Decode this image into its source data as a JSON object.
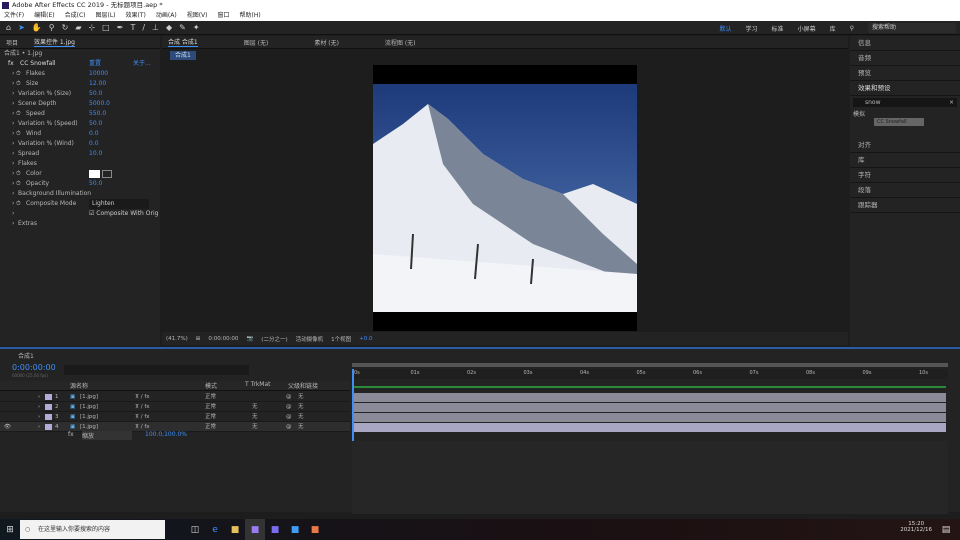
{
  "window": {
    "title": "Adobe After Effects CC 2019 - 无标题项目.aep *"
  },
  "menu": [
    "文件(F)",
    "编辑(E)",
    "合成(C)",
    "图层(L)",
    "效果(T)",
    "动画(A)",
    "视图(V)",
    "窗口",
    "帮助(H)"
  ],
  "toolbar": {
    "workspaces": [
      "默认",
      "学习",
      "标准",
      "小屏幕",
      "库"
    ],
    "search_placeholder": "搜索帮助"
  },
  "effects_panel": {
    "tabs": [
      "项目",
      "效果控件 1.jpg"
    ],
    "breadcrumb": "合成1 • 1.jpg",
    "effect_name": "CC Snowfall",
    "reset": "重置",
    "about": "关于...",
    "params": [
      {
        "name": "Flakes",
        "value": "10000",
        "stopwatch": true
      },
      {
        "name": "Size",
        "value": "12.00",
        "stopwatch": true
      },
      {
        "name": "Variation % (Size)",
        "value": "50.0"
      },
      {
        "name": "Scene Depth",
        "value": "5000.0"
      },
      {
        "name": "Speed",
        "value": "550.0",
        "stopwatch": true
      },
      {
        "name": "Variation % (Speed)",
        "value": "50.0"
      },
      {
        "name": "Wind",
        "value": "0.0",
        "stopwatch": true
      },
      {
        "name": "Variation % (Wind)",
        "value": "0.0"
      },
      {
        "name": "Spread",
        "value": "10.0"
      },
      {
        "name": "Flakes",
        "value": ""
      },
      {
        "name": "Color",
        "value": "",
        "stopwatch": true
      },
      {
        "name": "Opacity",
        "value": "50.0",
        "stopwatch": true
      },
      {
        "name": "Background Illumination",
        "value": ""
      },
      {
        "name": "Composite Mode",
        "value": "Lighten",
        "stopwatch": true
      },
      {
        "name": "",
        "value": "Composite With Orig"
      },
      {
        "name": "Extras",
        "value": ""
      }
    ]
  },
  "viewer": {
    "tabs": [
      "合成 合成1",
      "图层 (无)",
      "素材 (无)",
      "流程图 (无)"
    ],
    "comp_chip": "合成1",
    "zoom": "(41.7%)",
    "timecode": "0:00:00:00",
    "resolution": "(二分之一)",
    "camera": "活动摄像机",
    "views": "1个视图",
    "offset": "+0.0"
  },
  "right_panel": {
    "items_top": [
      "信息",
      "音频",
      "预览"
    ],
    "effects_presets": "效果和预设",
    "search_value": "snow",
    "category": "模拟",
    "result": "CC Snowfall",
    "items_bottom": [
      "对齐",
      "库",
      "字符",
      "段落",
      "跟踪器"
    ]
  },
  "timeline": {
    "tab": "合成1",
    "timecode": "0:00:00:00",
    "fps": "00000 (25.00 fps)",
    "search_placeholder": "",
    "columns": {
      "source": "源名称",
      "mode": "模式",
      "trkmat": "T TrkMat",
      "parent": "父级和链接"
    },
    "layers": [
      {
        "num": "1",
        "name": "[1.jpg]",
        "mode": "正常",
        "trk": "",
        "parent": "无"
      },
      {
        "num": "2",
        "name": "[1.jpg]",
        "mode": "正常",
        "trk": "无",
        "parent": "无"
      },
      {
        "num": "3",
        "name": "[1.jpg]",
        "mode": "正常",
        "trk": "无",
        "parent": "无"
      },
      {
        "num": "4",
        "name": "[1.jpg]",
        "mode": "正常",
        "trk": "无",
        "parent": "无"
      }
    ],
    "sublayer": {
      "label": "fx",
      "name": "缩放",
      "value": "100.0,100.0%"
    },
    "ruler": [
      "0s",
      "01s",
      "02s",
      "03s",
      "04s",
      "05s",
      "06s",
      "07s",
      "08s",
      "09s",
      "10s"
    ]
  },
  "taskbar": {
    "search": "在这里输入你要搜索的内容",
    "time": "15:20",
    "date": "2021/12/16"
  }
}
